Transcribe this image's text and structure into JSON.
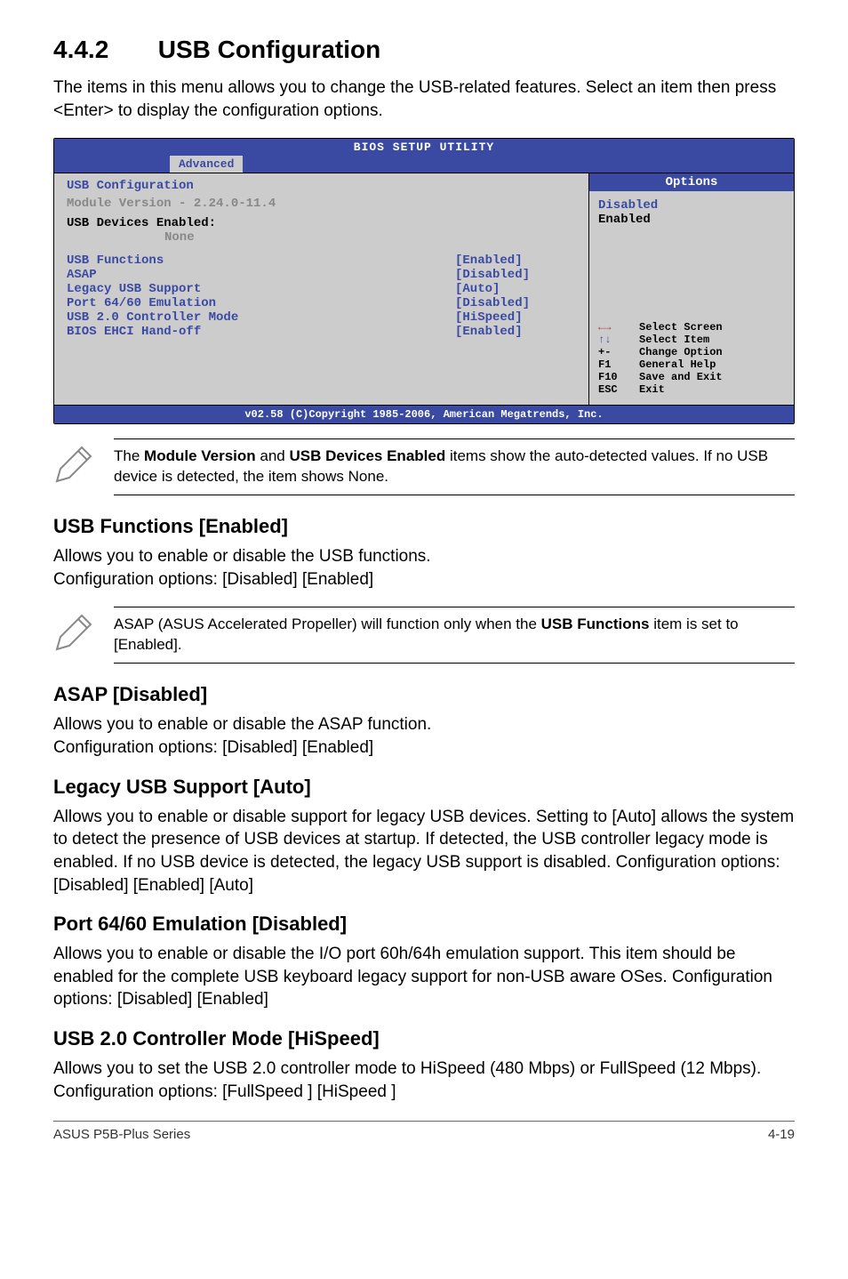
{
  "section": {
    "number": "4.4.2",
    "title": "USB Configuration"
  },
  "intro": "The items in this menu allows you to change the USB-related features. Select an item then press <Enter> to display the configuration options.",
  "bios": {
    "title": "BIOS SETUP UTILITY",
    "tab": "Advanced",
    "left_header": "USB Configuration",
    "module_line": "Module Version - 2.24.0-11.4",
    "devices_label": "USB Devices Enabled:",
    "devices_value": "None",
    "rows": [
      {
        "label": "USB Functions",
        "value": "[Enabled]"
      },
      {
        "label": "ASAP",
        "value": "[Disabled]"
      },
      {
        "label": "Legacy USB Support",
        "value": "[Auto]"
      },
      {
        "label": "Port 64/60 Emulation",
        "value": "[Disabled]"
      },
      {
        "label": "USB 2.0 Controller Mode",
        "value": "[HiSpeed]"
      },
      {
        "label": "BIOS EHCI Hand-off",
        "value": "[Enabled]"
      }
    ],
    "options_header": "Options",
    "option_disabled": "Disabled",
    "option_enabled": "Enabled",
    "keyhelp": [
      {
        "key": "←→",
        "desc": "Select Screen",
        "cls": "arrows-h"
      },
      {
        "key": "↑↓",
        "desc": "Select Item",
        "cls": "arrows-v"
      },
      {
        "key": "+-",
        "desc": "Change Option",
        "cls": ""
      },
      {
        "key": "F1",
        "desc": "General Help",
        "cls": ""
      },
      {
        "key": "F10",
        "desc": "Save and Exit",
        "cls": ""
      },
      {
        "key": "ESC",
        "desc": "Exit",
        "cls": ""
      }
    ],
    "copyright": "v02.58 (C)Copyright 1985-2006, American Megatrends, Inc."
  },
  "note1_a": "The ",
  "note1_b": "Module Version",
  "note1_c": " and ",
  "note1_d": "USB Devices Enabled",
  "note1_e": " items show the auto-detected values. If no USB device is detected, the item shows None.",
  "usb_func": {
    "heading": "USB Functions [Enabled]",
    "p1": "Allows you to enable or disable the USB functions.",
    "p2": "Configuration options: [Disabled] [Enabled]"
  },
  "note2_a": "ASAP (ASUS Accelerated Propeller) will function only when the ",
  "note2_b": "USB Functions",
  "note2_c": " item is set to [Enabled].",
  "asap": {
    "heading": "ASAP [Disabled]",
    "p1": "Allows you to enable or disable the ASAP function.",
    "p2": "Configuration options: [Disabled] [Enabled]"
  },
  "legacy": {
    "heading": "Legacy USB Support [Auto]",
    "p": "Allows you to enable or disable support for legacy USB devices. Setting to [Auto] allows the system to detect the presence of USB devices at startup. If detected, the USB controller legacy mode is enabled. If no USB device is detected, the legacy USB support is disabled. Configuration options: [Disabled] [Enabled] [Auto]"
  },
  "port": {
    "heading": "Port 64/60 Emulation [Disabled]",
    "p": "Allows you to enable or disable the I/O port 60h/64h emulation support. This item should be enabled for the complete USB keyboard legacy support for non-USB aware OSes. Configuration options: [Disabled] [Enabled]"
  },
  "ctrlmode": {
    "heading": "USB 2.0 Controller Mode [HiSpeed]",
    "p": "Allows you to set the USB 2.0 controller mode to HiSpeed (480 Mbps) or FullSpeed (12 Mbps). Configuration options: [FullSpeed ] [HiSpeed ]"
  },
  "footer_left": "ASUS P5B-Plus Series",
  "footer_right": "4-19"
}
